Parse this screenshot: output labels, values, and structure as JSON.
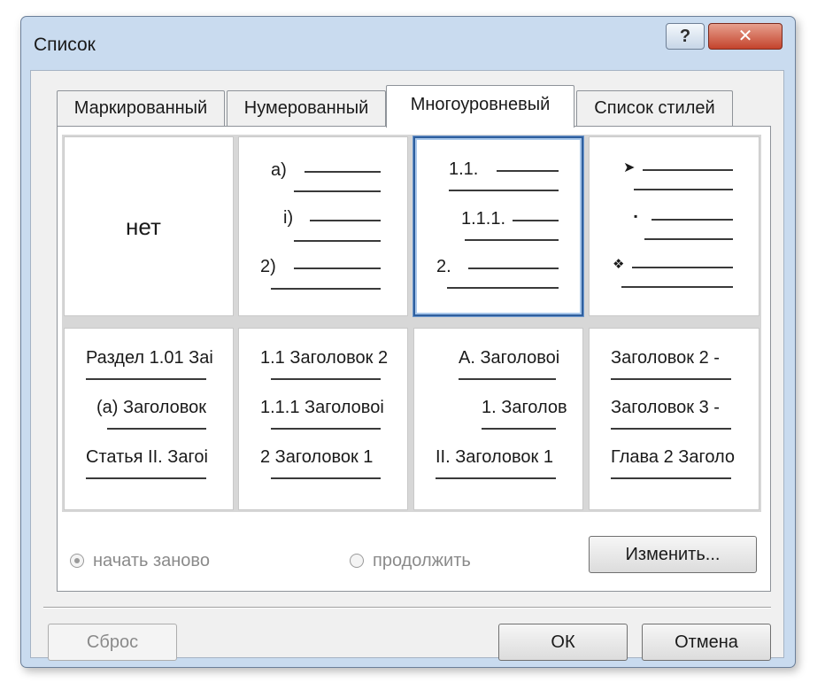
{
  "window": {
    "title": "Список",
    "help_glyph": "?",
    "close_glyph": "✕"
  },
  "tabs": [
    {
      "label": "Маркированный"
    },
    {
      "label": "Нумерованный"
    },
    {
      "label": "Многоуровневый",
      "active": true
    },
    {
      "label": "Список стилей"
    }
  ],
  "gallery": {
    "none": {
      "label": "нет"
    },
    "alpha": {
      "l1": "a)",
      "l2": "i)",
      "l3": "2)"
    },
    "decimal": {
      "l1": "1.1.",
      "l2": "1.1.1.",
      "l3": "2."
    },
    "bullets": {
      "l1": "➤",
      "l2": "▪",
      "l3": "❖"
    },
    "headings_section": {
      "l1": "Раздел 1.01 Заі",
      "l2": "(а) Заголовок",
      "l3": "Статья ІІ. Загоі"
    },
    "headings_decimal": {
      "l1": "1.1 Заголовок 2",
      "l2": "1.1.1 Заголовоі",
      "l3": "2 Заголовок 1"
    },
    "headings_outline": {
      "l1": "А. Заголовоі",
      "l2": "1. Заголов",
      "l3": "ІІ. Заголовок 1"
    },
    "headings_chapter": {
      "l1": "Заголовок 2 -",
      "l2": "Заголовок 3 -",
      "l3": "Глава 2 Заголо"
    }
  },
  "options": {
    "restart_label": "начать заново",
    "continue_label": "продолжить",
    "restart_checked": true,
    "modify_label": "Изменить..."
  },
  "buttons": {
    "reset_label": "Сброс",
    "ok_label": "ОК",
    "cancel_label": "Отмена"
  }
}
